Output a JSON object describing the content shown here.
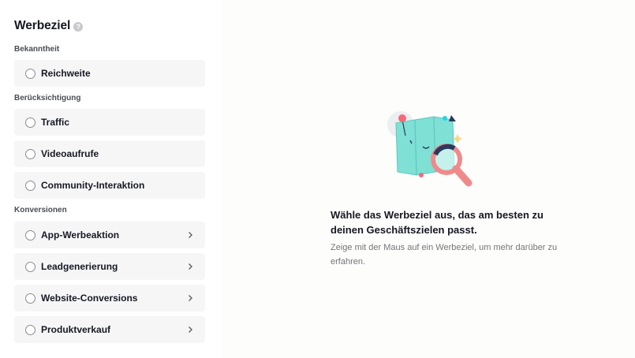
{
  "header": {
    "title": "Werbeziel",
    "help_icon": "?"
  },
  "groups": [
    {
      "label": "Bekanntheit"
    },
    {
      "label": "Berücksichtigung"
    },
    {
      "label": "Konversionen"
    }
  ],
  "options": [
    {
      "label": "Reichweite",
      "has_chevron": false
    },
    {
      "label": "Traffic",
      "has_chevron": false
    },
    {
      "label": "Videoaufrufe",
      "has_chevron": false
    },
    {
      "label": "Community-Interaktion",
      "has_chevron": false
    },
    {
      "label": "App-Werbeaktion",
      "has_chevron": true
    },
    {
      "label": "Leadgenerierung",
      "has_chevron": true
    },
    {
      "label": "Website-Conversions",
      "has_chevron": true
    },
    {
      "label": "Produktverkauf",
      "has_chevron": true
    }
  ],
  "empty_state": {
    "illustration": "map-magnifier-illustration",
    "headline": "Wähle das Werbeziel aus, das am besten zu deinen Geschäftszielen passt.",
    "description": "Zeige mit der Maus auf ein Werbeziel, um mehr darüber zu erfahren."
  },
  "colors": {
    "map": "#7fe0d6",
    "magnifier": "#f08a8a",
    "pin": "#f26b7a",
    "accent_cyan": "#25d4e6",
    "navy": "#2a3a5c"
  }
}
